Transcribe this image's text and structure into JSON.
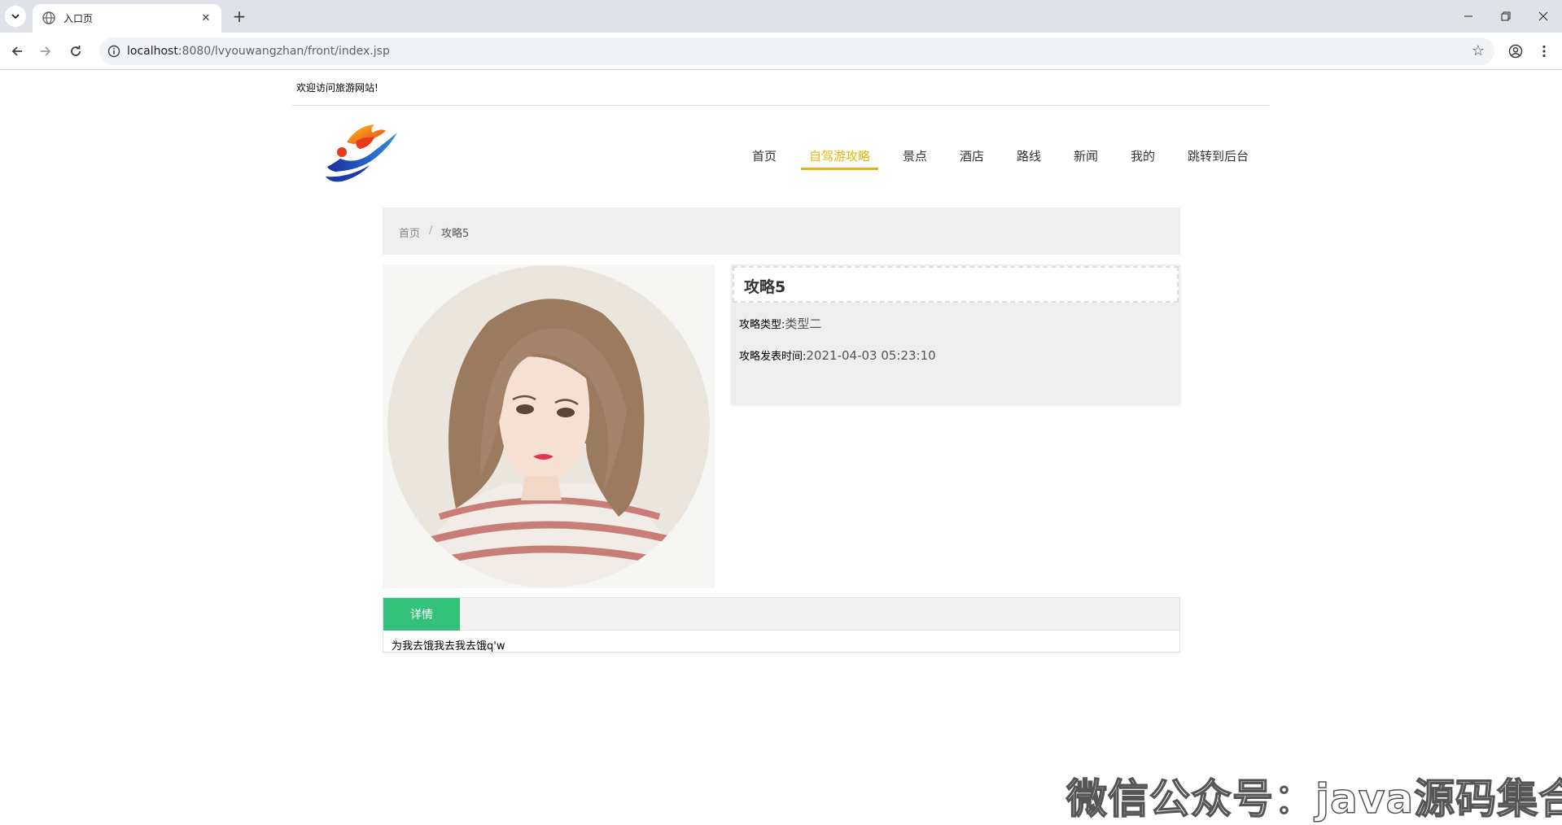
{
  "browser": {
    "tab_title": "入口页",
    "url_host": "localhost",
    "url_rest": ":8080/lvyouwangzhan/front/index.jsp",
    "icons": [
      "tab-list-icon",
      "globe-icon",
      "close-icon",
      "plus-icon",
      "back-icon",
      "forward-icon",
      "reload-icon",
      "info-icon",
      "star-icon",
      "profile-icon",
      "more-icon",
      "minimize-icon",
      "restore-icon",
      "window-close-icon"
    ]
  },
  "site": {
    "welcome": "欢迎访问旅游网站!",
    "nav": [
      {
        "label": "首页"
      },
      {
        "label": "自驾游攻略"
      },
      {
        "label": "景点"
      },
      {
        "label": "酒店"
      },
      {
        "label": "路线"
      },
      {
        "label": "新闻"
      },
      {
        "label": "我的"
      },
      {
        "label": "跳转到后台"
      }
    ],
    "active_nav_color": "#e4b60d"
  },
  "breadcrumb": {
    "home": "首页",
    "separator": "/",
    "current": "攻略5"
  },
  "detail": {
    "title": "攻略5",
    "type_label": "攻略类型:",
    "type_value": "类型二",
    "time_label": "攻略发表时间:",
    "time_value": "2021-04-03 05:23:10",
    "tab_label": "详情",
    "content": "为我去饿我去我去饿q'w",
    "tab_color": "#34c17b"
  },
  "watermark": "微信公众号：java源码集合"
}
